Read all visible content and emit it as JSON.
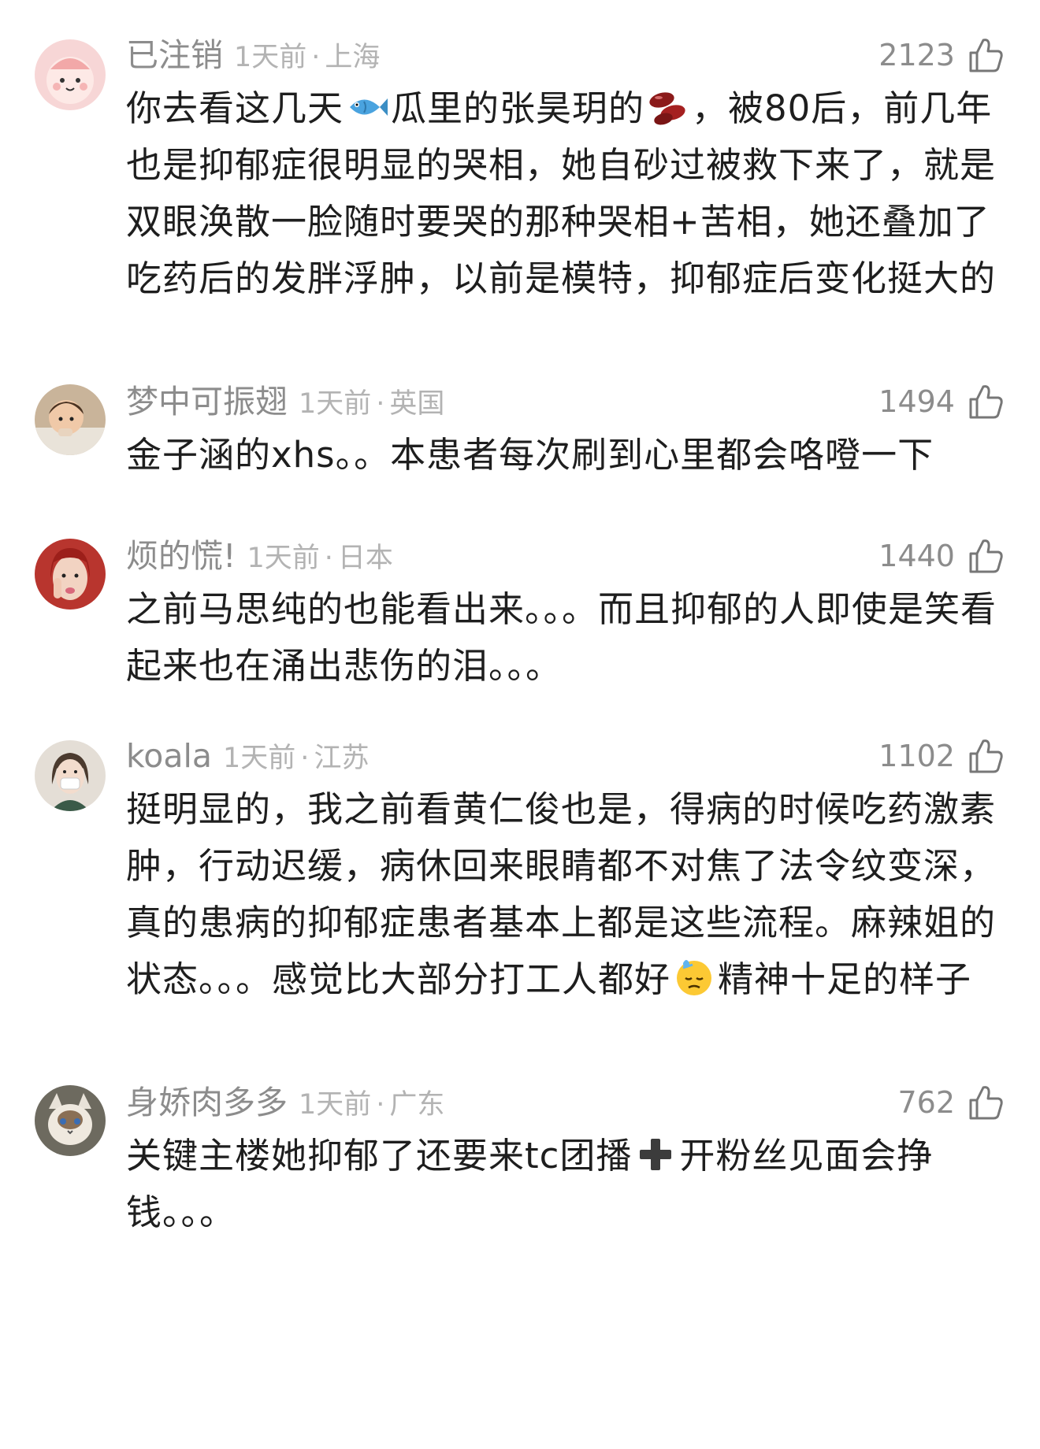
{
  "comments": [
    {
      "username": "已注销",
      "time": "1天前",
      "location": "上海",
      "likes": "2123",
      "text_parts": [
        "你去看这几天",
        "瓜里的张昊玥的",
        "，被80后，前几年也是抑郁症很明显的哭相，她自砂过被救下来了，就是双眼涣散一脸随时要哭的那种哭相+苦相，她还叠加了吃药后的发胖浮肿，以前是模特，抑郁症后变化挺大的"
      ],
      "icons": [
        "fish-emoji",
        "beans-emoji"
      ]
    },
    {
      "username": "梦中可振翅",
      "time": "1天前",
      "location": "英国",
      "likes": "1494",
      "text": "金子涵的xhs。。本患者每次刷到心里都会咯噔一下"
    },
    {
      "username": "烦的慌!",
      "time": "1天前",
      "location": "日本",
      "likes": "1440",
      "text": "之前马思纯的也能看出来。。。而且抑郁的人即使是笑看起来也在涌出悲伤的泪。。。"
    },
    {
      "username": "koala",
      "time": "1天前",
      "location": "江苏",
      "likes": "1102",
      "text_parts": [
        "挺明显的，我之前看黄仁俊也是，得病的时候吃药激素肿，行动迟缓，病休回来眼睛都不对焦了法令纹变深，真的患病的抑郁症患者基本上都是这些流程。麻辣姐的状态。。。感觉比大部分打工人都好",
        "精神十足的样子"
      ],
      "icons": [
        "sweat-face-emoji"
      ]
    },
    {
      "username": "身娇肉多多",
      "time": "1天前",
      "location": "广东",
      "likes": "762",
      "text_parts": [
        "关键主楼她抑郁了还要来tc团播",
        "开粉丝见面会挣钱。。。"
      ],
      "icons": [
        "plus-emoji"
      ]
    }
  ],
  "separator": "·",
  "colors": {
    "username": "#8c8c8c",
    "meta": "#b3b3b3",
    "text": "#1e1e1e",
    "background": "#ffffff"
  }
}
